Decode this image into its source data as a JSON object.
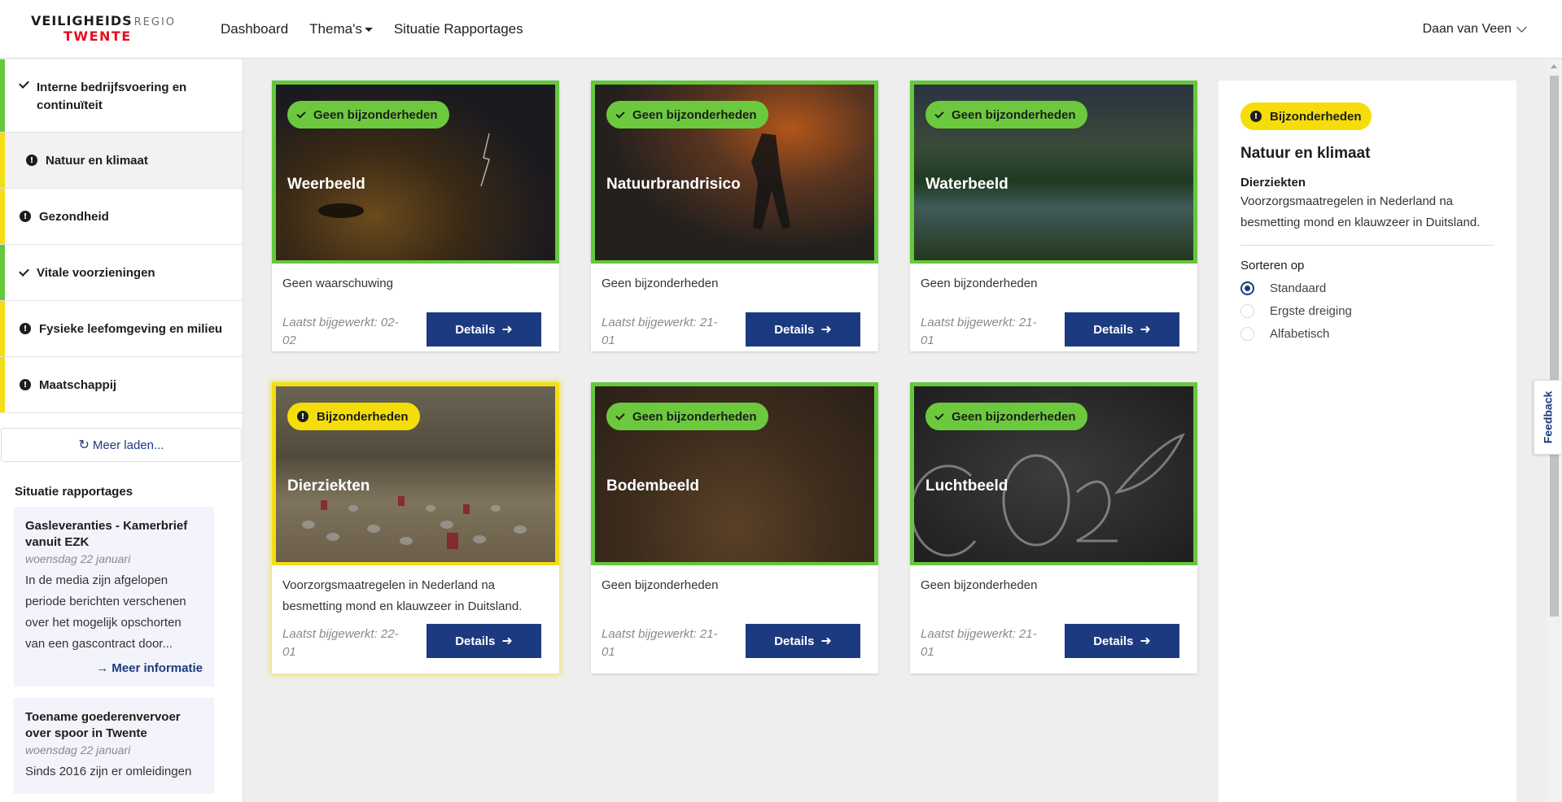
{
  "header": {
    "logo_line1": "VEILIGHEIDS",
    "logo_line1_suffix": "REGIO",
    "logo_line2": "TWENTE",
    "nav": [
      {
        "label": "Dashboard"
      },
      {
        "label": "Thema's"
      },
      {
        "label": "Situatie Rapportages"
      }
    ],
    "user": "Daan van Veen"
  },
  "sidebar": {
    "categories": [
      {
        "label": "Interne bedrijfsvoering en continuïteit",
        "status": "ok",
        "color": "#65c73c"
      },
      {
        "label": "Natuur en klimaat",
        "status": "warn",
        "color": "#f3dd14"
      },
      {
        "label": "Gezondheid",
        "status": "warn",
        "color": "#f3dd14"
      },
      {
        "label": "Vitale voorzieningen",
        "status": "ok",
        "color": "#65c73c"
      },
      {
        "label": "Fysieke leefomgeving en milieu",
        "status": "warn",
        "color": "#f3dd14"
      },
      {
        "label": "Maatschappij",
        "status": "warn",
        "color": "#f3dd14"
      }
    ],
    "load_more": "Meer laden...",
    "reports_title": "Situatie rapportages",
    "reports": [
      {
        "title": "Gasleveranties - Kamerbrief vanuit EZK",
        "date": "woensdag 22 januari",
        "text": "In de media zijn afgelopen periode berichten verschenen over het mogelijk opschorten van een gascontract door...",
        "link": "Meer informatie"
      },
      {
        "title": "Toename goederenvervoer over spoor in Twente",
        "date": "woensdag 22 januari",
        "text": "Sinds 2016 zijn er omleidingen"
      }
    ]
  },
  "cards": [
    {
      "badge": "Geen bijzonderheden",
      "title": "Weerbeeld",
      "desc": "Geen waarschuwing",
      "updated": "Laatst bijgewerkt: 02-02",
      "button": "Details"
    },
    {
      "badge": "Geen bijzonderheden",
      "title": "Natuurbrandrisico",
      "desc": "Geen bijzonderheden",
      "updated": "Laatst bijgewerkt: 21-01",
      "button": "Details"
    },
    {
      "badge": "Geen bijzonderheden",
      "title": "Waterbeeld",
      "desc": "Geen bijzonderheden",
      "updated": "Laatst bijgewerkt: 21-01",
      "button": "Details"
    },
    {
      "badge": "Bijzonderheden",
      "title": "Dierziekten",
      "desc": "Voorzorgsmaatregelen in Nederland na besmetting mond en klauwzeer in Duitsland.",
      "updated": "Laatst bijgewerkt: 22-01",
      "button": "Details"
    },
    {
      "badge": "Geen bijzonderheden",
      "title": "Bodembeeld",
      "desc": "Geen bijzonderheden",
      "updated": "Laatst bijgewerkt: 21-01",
      "button": "Details"
    },
    {
      "badge": "Geen bijzonderheden",
      "title": "Luchtbeeld",
      "desc": "Geen bijzonderheden",
      "updated": "Laatst bijgewerkt: 21-01",
      "button": "Details"
    }
  ],
  "panel": {
    "badge": "Bijzonderheden",
    "title": "Natuur en klimaat",
    "subtitle": "Dierziekten",
    "text": "Voorzorgsmaatregelen in Nederland na besmetting mond en klauwzeer in Duitsland.",
    "sort_label": "Sorteren op",
    "sort_options": [
      {
        "label": "Standaard",
        "selected": true
      },
      {
        "label": "Ergste dreiging",
        "selected": false
      },
      {
        "label": "Alfabetisch",
        "selected": false
      }
    ]
  },
  "feedback": "Feedback",
  "colors": {
    "ok": "#65c73c",
    "warn": "#f3dd14",
    "primary": "#1c3a80",
    "brand_red": "#e3101f"
  }
}
